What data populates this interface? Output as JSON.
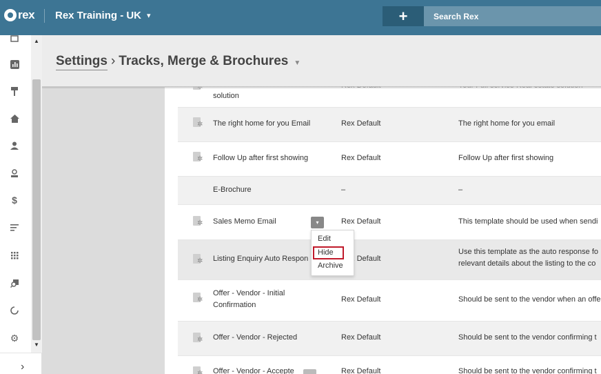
{
  "app": {
    "logo_text": "rex",
    "account_name": "Rex Training - UK"
  },
  "search": {
    "placeholder": "Search Rex"
  },
  "plus_label": "+",
  "sidebar": {
    "icons": [
      "calendar-icon",
      "reports-icon",
      "signboard-icon",
      "home-icon",
      "contact-icon",
      "building-icon",
      "dollar-icon",
      "lists-icon",
      "apps-grid-icon",
      "search-property-icon",
      "refresh-icon",
      "settings-icon"
    ],
    "expand_glyph": "›"
  },
  "header": {
    "root": "Settings",
    "separator": "›",
    "title": "Tracks, Merge & Brochures"
  },
  "rows": [
    {
      "name": "solution",
      "owner": "Rex Default",
      "description": "Your Full service Real estate solution"
    },
    {
      "name": "The right home for you Email",
      "owner": "Rex Default",
      "description": "The right home for you email"
    },
    {
      "name": "Follow Up after first showing",
      "owner": "Rex Default",
      "description": "Follow Up after first showing"
    },
    {
      "name": "E-Brochure",
      "owner": "–",
      "description": "–"
    },
    {
      "name": "Sales Memo Email",
      "owner": "Rex Default",
      "description": "This template should be used when sendi"
    },
    {
      "name": "Listing Enquiry Auto Respon",
      "owner": "Rex Default",
      "description": "Use this template as the auto response fo relevant details about the listing to the co"
    },
    {
      "name": "Offer - Vendor - Initial Confirmation",
      "owner": "Rex Default",
      "description": "Should be sent to the vendor when an offe"
    },
    {
      "name": "Offer - Vendor - Rejected",
      "owner": "Rex Default",
      "description": "Should be sent to the vendor confirming t"
    },
    {
      "name": "Offer - Vendor - Accepte",
      "owner": "Rex Default",
      "description": "Should be sent to the vendor confirming t"
    }
  ],
  "menu": {
    "items": [
      "Edit",
      "Hide",
      "Archive"
    ],
    "highlighted": "Hide"
  },
  "colors": {
    "topbar": "#3d7594",
    "highlight": "#c0192a"
  }
}
